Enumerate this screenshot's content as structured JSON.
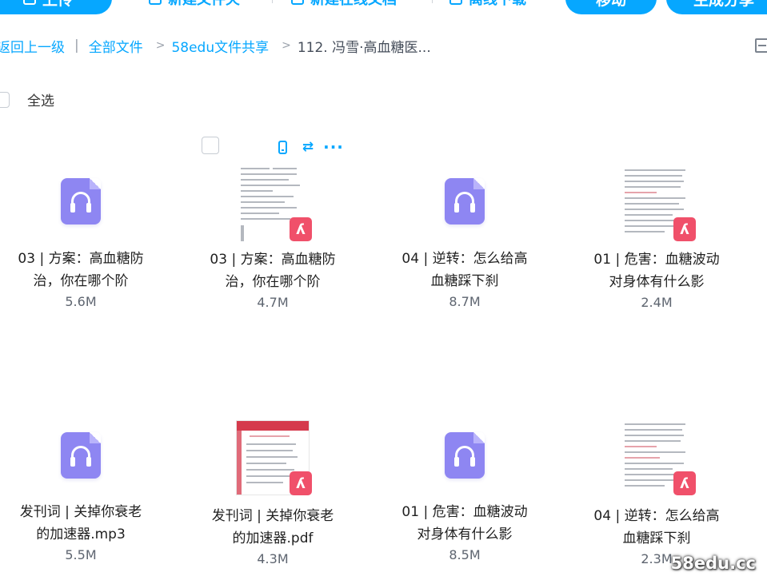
{
  "toolbar": {
    "upload_label": "上传",
    "new_folder_label": "新建文件夹",
    "new_doc_label": "新建在线文档",
    "offline_label": "离线下载",
    "move_label": "移动",
    "generate_label": "生成分享"
  },
  "breadcrumb": {
    "back_label": "返回上一级",
    "divider": "|",
    "all_files": "全部文件",
    "arrow": ">",
    "share_folder": "58edu文件共享",
    "current": "112. 冯雪·高血糖医..."
  },
  "select_all_label": "全选",
  "hover_tools": {
    "phone_icon": "phone-icon",
    "transfer_icon": "transfer-icon",
    "more_icon": "more-icon",
    "more_label": "···",
    "transfer_label": "⇄"
  },
  "files": [
    {
      "name": "03 | 方案：高血糖防治，你在哪个阶",
      "size": "5.6M",
      "type": "audio"
    },
    {
      "name": "03 | 方案：高血糖防治，你在哪个阶",
      "size": "4.7M",
      "type": "pdf"
    },
    {
      "name": "04 | 逆转：怎么给高血糖踩下刹",
      "size": "8.7M",
      "type": "audio"
    },
    {
      "name": "01 | 危害：血糖波动对身体有什么影",
      "size": "2.4M",
      "type": "pdf"
    },
    {
      "name": "发刊词 | 关掉你衰老的加速器.mp3",
      "size": "5.5M",
      "type": "audio"
    },
    {
      "name": "发刊词 | 关掉你衰老的加速器.pdf",
      "size": "4.3M",
      "type": "pdf"
    },
    {
      "name": "01 | 危害：血糖波动对身体有什么影",
      "size": "8.5M",
      "type": "audio"
    },
    {
      "name": "04 | 逆转：怎么给高血糖踩下刹",
      "size": "2.3M",
      "type": "pdf"
    }
  ],
  "watermark": "58edu.cc",
  "colors": {
    "accent": "#06a7ff",
    "audio": "#8e86f2",
    "pdf": "#f0506a"
  }
}
